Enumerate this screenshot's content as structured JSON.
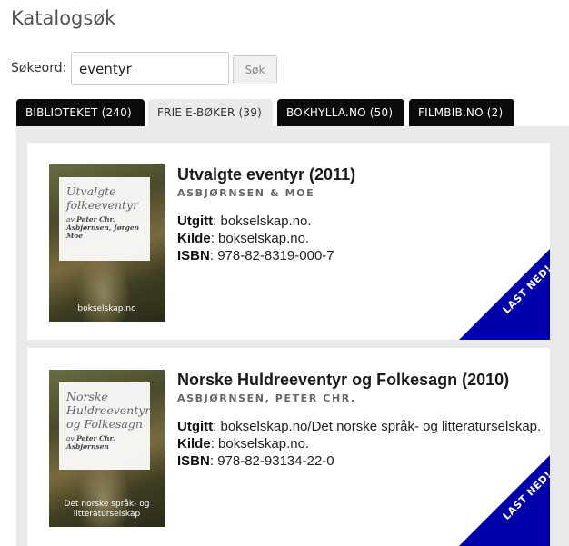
{
  "page": {
    "title": "Katalogsøk"
  },
  "search": {
    "label": "Søkeord:",
    "value": "eventyr",
    "button": "Søk"
  },
  "tabs": [
    {
      "label": "BIBLIOTEKET (240)",
      "active": false
    },
    {
      "label": "FRIE E-BØKER (39)",
      "active": true
    },
    {
      "label": "BOKHYLLA.NO (50)",
      "active": false
    },
    {
      "label": "FILMBIB.NO (2)",
      "active": false
    }
  ],
  "labels": {
    "published": "Utgitt",
    "source": "Kilde",
    "isbn": "ISBN"
  },
  "books": [
    {
      "title": "Utvalgte eventyr (2011)",
      "author": "ASBJØRNSEN & MOE",
      "published": "bokselskap.no.",
      "source": "bokselskap.no.",
      "isbn": "978-82-8319-000-7",
      "cover": {
        "title_line1": "Utvalgte",
        "title_line2": "folkeeventyr",
        "author_prefix": "av",
        "author": "Peter Chr. Asbjørnsen, Jørgen Moe",
        "publisher": "bokselskap.no"
      },
      "ribbon": "LAST NED!"
    },
    {
      "title": "Norske Huldreeventyr og Folkesagn (2010)",
      "author": "ASBJØRNSEN, PETER CHR.",
      "published": "bokselskap.no/Det norske språk- og litteraturselskap.",
      "source": "bokselskap.no.",
      "isbn": "978-82-93134-22-0",
      "cover": {
        "title_line1": "Norske",
        "title_line2": "Huldreeventyr",
        "title_line3": "og Folkesagn",
        "author_prefix": "av",
        "author": "Peter Chr. Asbjørnsen",
        "publisher_line1": "Det norske språk- og",
        "publisher_line2": "litteraturselskap"
      },
      "ribbon": "LAST NED!"
    }
  ],
  "colors": {
    "ribbon": "#0000aa",
    "tab_dark": "#0b0b0b",
    "panel_bg": "#e9e9e9"
  }
}
